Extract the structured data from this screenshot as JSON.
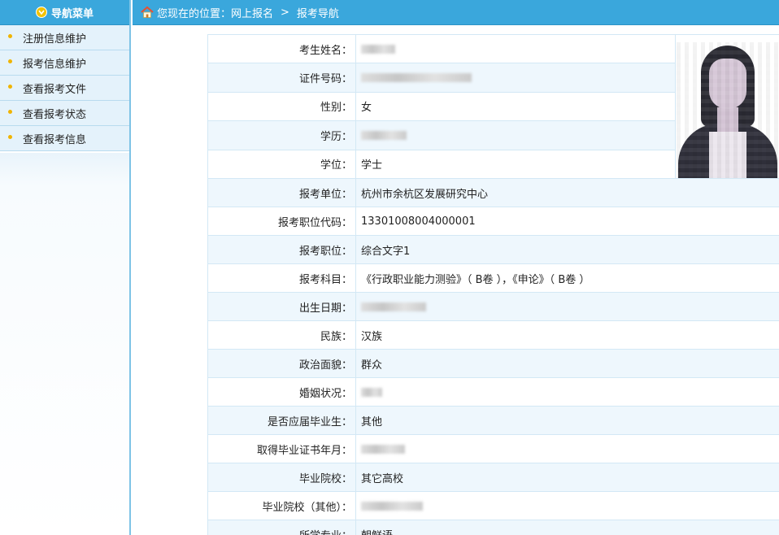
{
  "sidebar": {
    "title": "导航菜单",
    "items": [
      {
        "label": "注册信息维护"
      },
      {
        "label": "报考信息维护"
      },
      {
        "label": "查看报考文件"
      },
      {
        "label": "查看报考状态"
      },
      {
        "label": "查看报考信息"
      }
    ]
  },
  "topbar": {
    "prefix": "您现在的位置：网上报名",
    "separator": ">",
    "current": "报考导航"
  },
  "form": {
    "rows": [
      {
        "label": "考生姓名：",
        "value": ""
      },
      {
        "label": "证件号码：",
        "value": ""
      },
      {
        "label": "性别：",
        "value": "女"
      },
      {
        "label": "学历：",
        "value": ""
      },
      {
        "label": "学位：",
        "value": "学士"
      },
      {
        "label": "报考单位：",
        "value": "杭州市余杭区发展研究中心"
      },
      {
        "label": "报考职位代码：",
        "value": "13301008004000001"
      },
      {
        "label": "报考职位：",
        "value": "综合文字1"
      },
      {
        "label": "报考科目：",
        "value": "《行政职业能力测验》（ B卷 ），《申论》（ B卷 ）"
      },
      {
        "label": "出生日期：",
        "value": ""
      },
      {
        "label": "民族：",
        "value": "汉族"
      },
      {
        "label": "政治面貌：",
        "value": "群众"
      },
      {
        "label": "婚姻状况：",
        "value": ""
      },
      {
        "label": "是否应届毕业生：",
        "value": "其他"
      },
      {
        "label": "取得毕业证书年月：",
        "value": ""
      },
      {
        "label": "毕业院校：",
        "value": "其它高校"
      },
      {
        "label": "毕业院校（其他）：",
        "value": ""
      },
      {
        "label": "所学专业：",
        "value": "朝鲜语"
      }
    ]
  },
  "colors": {
    "header_blue": "#3aa7dc",
    "row_alt": "#eef7fd",
    "border": "#d3e8f5",
    "bullet": "#f0b400"
  }
}
